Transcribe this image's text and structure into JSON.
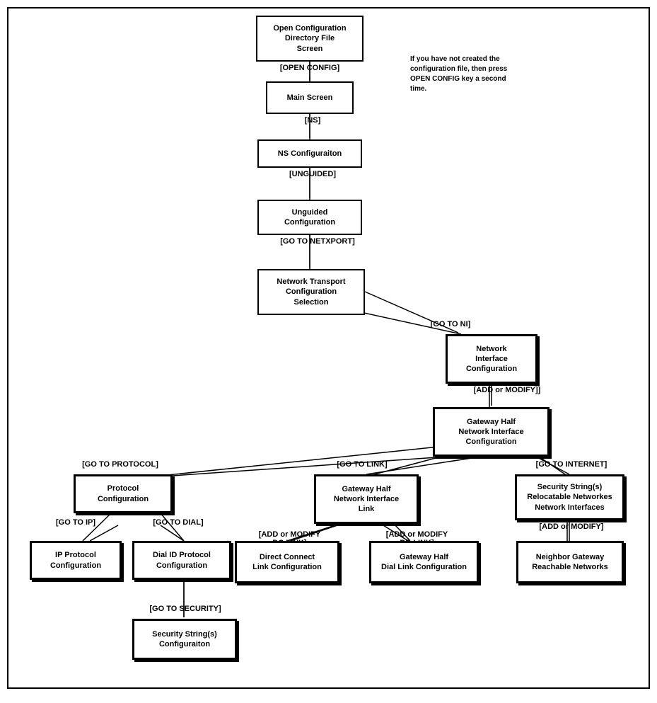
{
  "nodes": {
    "open_config": {
      "label": "Open Configuration\nDirectory File\nScreen"
    },
    "main_screen": {
      "label": "Main Screen"
    },
    "ns_config": {
      "label": "NS Configuraiton"
    },
    "unguided_config": {
      "label": "Unguided\nConfiguration"
    },
    "network_transport": {
      "label": "Network Transport\nConfiguration\nSelection"
    },
    "network_interface": {
      "label": "Network\nInterface\nConfiguration"
    },
    "gateway_half_ni": {
      "label": "Gateway Half\nNetwork Interface\nConfiguration"
    },
    "protocol_config": {
      "label": "Protocol\nConfiguration"
    },
    "gateway_half_link": {
      "label": "Gateway Half\nNetwork Interface\nLink"
    },
    "security_strings": {
      "label": "Security String(s)\nRelocatable Networkes\nNetwork Interfaces"
    },
    "ip_protocol": {
      "label": "IP Protocol\nConfiguration"
    },
    "dial_id_protocol": {
      "label": "Dial ID Protocol\nConfiguration"
    },
    "direct_connect": {
      "label": "Direct Connect\nLink Configuration"
    },
    "gateway_half_dial": {
      "label": "Gateway Half\nDial Link Configuration"
    },
    "neighbor_gateway": {
      "label": "Neighbor Gateway\nReachable Networks"
    },
    "security_config": {
      "label": "Security String(s)\nConfiguraiton"
    }
  },
  "labels": {
    "open_config": "[OPEN CONFIG]",
    "ns": "[NS]",
    "unguided": "[UNGUIDED]",
    "go_netxport": "[GO TO NETXPORT]",
    "go_ni": "[GO TO NI]",
    "add_modify": "[ADD or MODIFY]]",
    "go_protocol": "[GO TO PROTOCOL]",
    "go_link": "[GO TO LINK]",
    "go_internet": "[GO TO INTERNET]",
    "go_ip": "[GO TO IP]",
    "go_dial": "[GO TO DIAL]",
    "add_modify_dc": "[ADD or MODIFY\nDC LINK]",
    "add_modify_dd": "[ADD or MODIFY\nDD LINK]",
    "add_modify2": "[ADD or MODIFY]",
    "go_security": "[GO TO SECURITY]"
  },
  "note": "If you have not created the\nconfiguration file, then press\nOPEN CONFIG key a second\ntime."
}
